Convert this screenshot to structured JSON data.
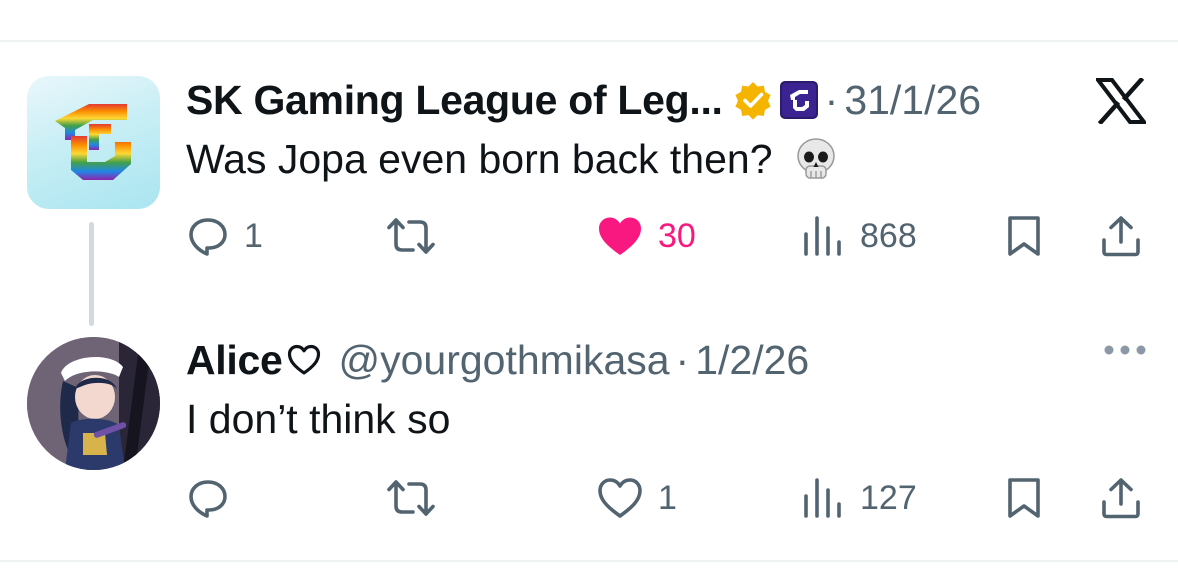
{
  "tweets": [
    {
      "author": {
        "display_name": "SK Gaming League of Leg...",
        "verified_badge": "gold-verified-icon",
        "affiliate_badge": "sk-affiliate-icon"
      },
      "separator": "·",
      "date": "31/1/26",
      "text": "Was Jopa even born back then?",
      "emoji": "skull-emoji",
      "metrics": {
        "replies": "1",
        "reposts": "",
        "likes": "30",
        "views": "868"
      },
      "liked": true,
      "corner_icon": "x-logo-icon"
    },
    {
      "author": {
        "display_name": "Alice",
        "name_suffix_icon": "heart-outline-icon",
        "handle": "@yourgothmikasa"
      },
      "separator": "·",
      "date": "1/2/26",
      "text": "I don’t think so",
      "metrics": {
        "replies": "",
        "reposts": "",
        "likes": "1",
        "views": "127"
      },
      "liked": false,
      "corner_icon": "more-icon"
    }
  ],
  "colors": {
    "text_primary": "#0f1419",
    "text_secondary": "#536471",
    "like_pink": "#f91880",
    "verified_gold": "#f4b400",
    "thread_line": "#cfd9de"
  }
}
